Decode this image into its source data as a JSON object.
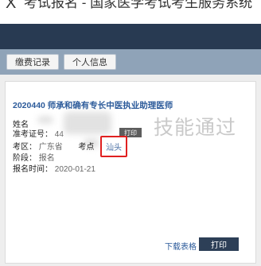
{
  "window": {
    "close_glyph": "X",
    "title": "考试报名 - 国家医学考试考生服务系统"
  },
  "nav": {
    "fee_record": "缴费记录",
    "personal_info": "个人信息"
  },
  "card": {
    "exam_title": "2020440 师承和确有专长中医执业助理医师",
    "name_label": "姓名",
    "ticket_label": "准考证号：",
    "ticket_value": "44",
    "print_small": "打印",
    "area_label": "考区：",
    "area_value": "广东省",
    "site_label": "考点",
    "site_value": "汕头",
    "stage_label": "阶段：",
    "stage_value": "报名",
    "time_label": "报名时间：",
    "time_value": "2020-01-21",
    "watermark": "技能通过",
    "download_label": "下载表格",
    "print_label": "打印"
  },
  "colors": {
    "header": "#283a52",
    "nav": "#8fa3b8",
    "link": "#2b5a9a",
    "highlight": "#e02020"
  }
}
